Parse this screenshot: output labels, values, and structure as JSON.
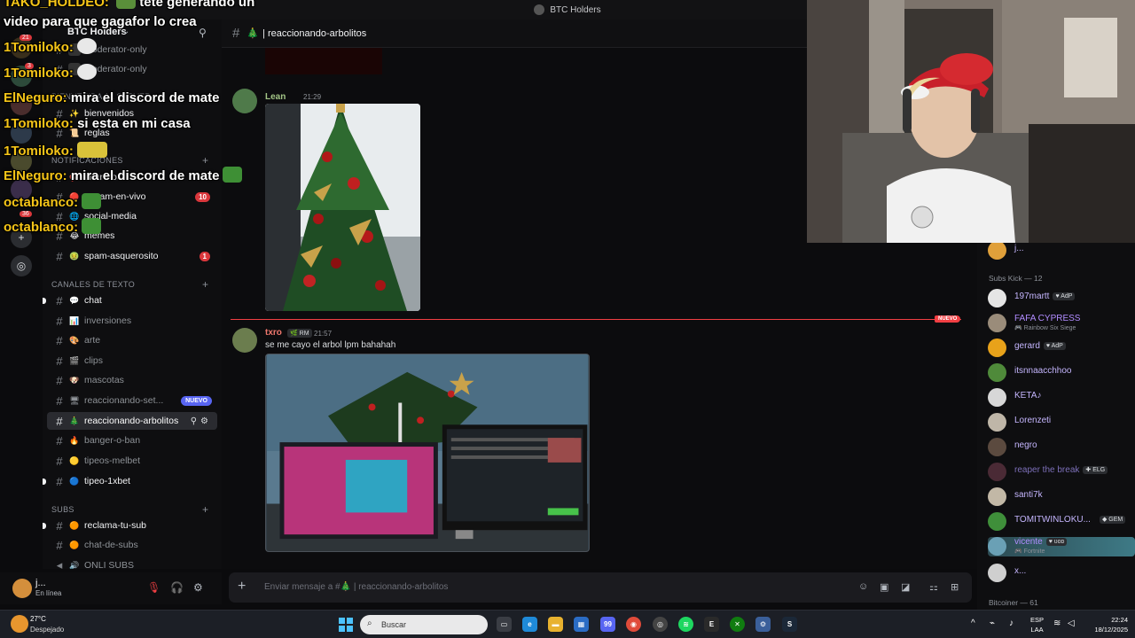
{
  "window": {
    "title": "BTC Holders"
  },
  "server": {
    "name": "BTC Holders"
  },
  "rail": {
    "badges": [
      "21",
      "3",
      "36"
    ]
  },
  "categories": {
    "bienvenida": "BIENVENIDA AL SERVER",
    "notificaciones": "NOTIFICACIONES",
    "canales_texto": "CANALES DE TEXTO",
    "subs": "SUBS"
  },
  "channels_top": [
    {
      "label": "moderator-only"
    },
    {
      "label": "moderator-only"
    }
  ],
  "channels_bienvenida": [
    {
      "label": "bienvenidos",
      "emoji": "✨"
    },
    {
      "label": "reglas",
      "emoji": "📜"
    }
  ],
  "channels_notif": [
    {
      "label": "anuncios",
      "emoji": "📢"
    },
    {
      "label": "stream-en-vivo",
      "emoji": "🔴",
      "badge": "10"
    },
    {
      "label": "social-media",
      "emoji": "🌐"
    },
    {
      "label": "memes",
      "emoji": "😂"
    },
    {
      "label": "spam-asquerosito",
      "emoji": "🤢",
      "badge": "1"
    }
  ],
  "channels_texto": [
    {
      "label": "chat",
      "emoji": "💬"
    },
    {
      "label": "inversiones",
      "emoji": "📊"
    },
    {
      "label": "arte",
      "emoji": "🎨"
    },
    {
      "label": "clips",
      "emoji": "🎬"
    },
    {
      "label": "mascotas",
      "emoji": "🐶"
    },
    {
      "label": "reaccionando-set...",
      "emoji": "🖥",
      "nuevo": "NUEVO"
    },
    {
      "label": "reaccionando-arbolitos",
      "emoji": "🎄"
    },
    {
      "label": "banger-o-ban",
      "emoji": "🔥"
    },
    {
      "label": "tipeos-melbet",
      "emoji": "🟡"
    },
    {
      "label": "tipeo-1xbet",
      "emoji": "🔵"
    }
  ],
  "channels_subs": [
    {
      "label": "reclama-tu-sub",
      "emoji": "🟠"
    },
    {
      "label": "chat-de-subs",
      "emoji": "🟠"
    },
    {
      "label": "ONLI SUBS",
      "emoji": "🔊"
    }
  ],
  "user": {
    "name": "j...",
    "status": "En línea"
  },
  "chat": {
    "channel": "reaccionando-arbolitos",
    "messages": [
      {
        "author": "Lean",
        "time": "21:29"
      },
      {
        "author": "txro",
        "tag": "RM",
        "time": "21:57",
        "text": "se me cayo el arbol lpm bahahah"
      }
    ],
    "new_label": "NUEVO",
    "input_placeholder": "Enviar mensaje a #🎄 | reaccionando-arbolitos"
  },
  "members": {
    "top_partial": "j...",
    "section1": "Subs Kick — 12",
    "list": [
      {
        "name": "197martt",
        "tag": "AdP",
        "color": "#c4b5fd",
        "avatar": "#e5e5e5"
      },
      {
        "name": "FAFA CYPRESS",
        "sub": "Rainbow Six Siege",
        "color": "#b18cff",
        "avatar": "#9a8c7a"
      },
      {
        "name": "gerard",
        "tag": "AdP",
        "color": "#c4b5fd",
        "avatar": "#e8a21a"
      },
      {
        "name": "itsnnaacchhoo",
        "color": "#c4b5fd",
        "avatar": "#4f8a3a"
      },
      {
        "name": "KETA♪",
        "color": "#c4b5fd",
        "avatar": "#d7d7d7"
      },
      {
        "name": "Lorenzeti",
        "color": "#c4b5fd",
        "avatar": "#bfb6a8"
      },
      {
        "name": "negro",
        "color": "#c4b5fd",
        "avatar": "#5b4a3f"
      },
      {
        "name": "reaper the break",
        "tag": "ELG",
        "color": "#7c6fb8",
        "avatar": "#4a2a35"
      },
      {
        "name": "santi7k",
        "color": "#c4b5fd",
        "avatar": "#c2b8a6"
      },
      {
        "name": "TOMITWINLOKU...",
        "tag": "GEM",
        "color": "#c4b5fd",
        "avatar": "#3f8f3a"
      },
      {
        "name": "vicente",
        "tag": "ᴜᴏᴅ",
        "sub": "Fortnite",
        "color": "#b18cff",
        "avatar": "#6aa0b5"
      },
      {
        "name": "x...",
        "color": "#c4b5fd",
        "avatar": "#cfcfcf"
      }
    ],
    "section2": "Bitcoiner — 61"
  },
  "overlay": [
    {
      "user": "TAKO_HOLDEO:",
      "msg": "tete generando un"
    },
    {
      "user": "",
      "msg": "video para que gagafor lo crea"
    },
    {
      "user": "1Tomiloko:",
      "msg": ""
    },
    {
      "user": "1Tomiloko:",
      "msg": ""
    },
    {
      "user": "ElNeguro:",
      "msg": "mira el discord de mate"
    },
    {
      "user": "1Tomiloko:",
      "msg": "si esta en mi casa"
    },
    {
      "user": "1Tomiloko:",
      "msg": ""
    },
    {
      "user": "ElNeguro:",
      "msg": "mira el discord de mate"
    },
    {
      "user": "octablanco:",
      "msg": ""
    },
    {
      "user": "octablanco:",
      "msg": ""
    }
  ],
  "taskbar": {
    "temp": "27°C",
    "condition": "Despejado",
    "search": "Buscar",
    "lang1": "ESP",
    "lang2": "LAA",
    "time": "22:24",
    "date": "18/12/2025",
    "discord_badge": "99"
  },
  "colors": {
    "accent": "#5865f2",
    "mention": "#da373c",
    "new": "#f23f43",
    "overlay_user": "#f5c518"
  }
}
